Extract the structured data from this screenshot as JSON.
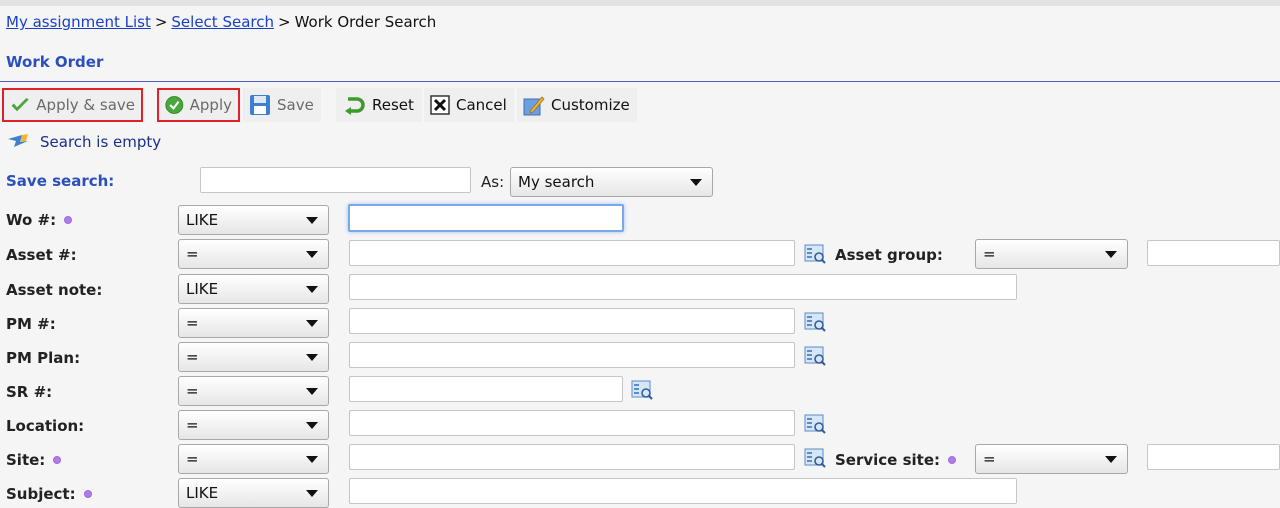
{
  "breadcrumb": {
    "link1": "My assignment List",
    "sep1": ">",
    "link2": "Select Search",
    "sep2": ">",
    "current": "Work Order Search"
  },
  "section_title": "Work Order",
  "toolbar": {
    "apply_save": "Apply & save",
    "apply": "Apply",
    "save": "Save",
    "reset": "Reset",
    "cancel": "Cancel",
    "customize": "Customize"
  },
  "status": {
    "text": "Search is empty"
  },
  "save_search": {
    "label": "Save search:",
    "value": "",
    "as_label": "As:",
    "as_value": "My search"
  },
  "rows": [
    {
      "label": "Wo #:",
      "operator": "LIKE",
      "value": ""
    },
    {
      "label": "Asset #:",
      "operator": "=",
      "value": ""
    },
    {
      "label": "Asset note:",
      "operator": "LIKE",
      "value": ""
    },
    {
      "label": "PM #:",
      "operator": "=",
      "value": ""
    },
    {
      "label": "PM Plan:",
      "operator": "=",
      "value": ""
    },
    {
      "label": "SR #:",
      "operator": "=",
      "value": ""
    },
    {
      "label": "Location:",
      "operator": "=",
      "value": ""
    },
    {
      "label": "Site:",
      "operator": "=",
      "value": ""
    },
    {
      "label": "Subject:",
      "operator": "LIKE",
      "value": ""
    }
  ],
  "asset_group": {
    "label": "Asset group:",
    "operator": "=",
    "value": ""
  },
  "service_site": {
    "label": "Service site:",
    "operator": "=",
    "value": ""
  },
  "colors": {
    "link": "#1a3fc7",
    "section": "#2a4fbf",
    "highlight": "#e0202a",
    "required_dot": "#b07bea"
  }
}
